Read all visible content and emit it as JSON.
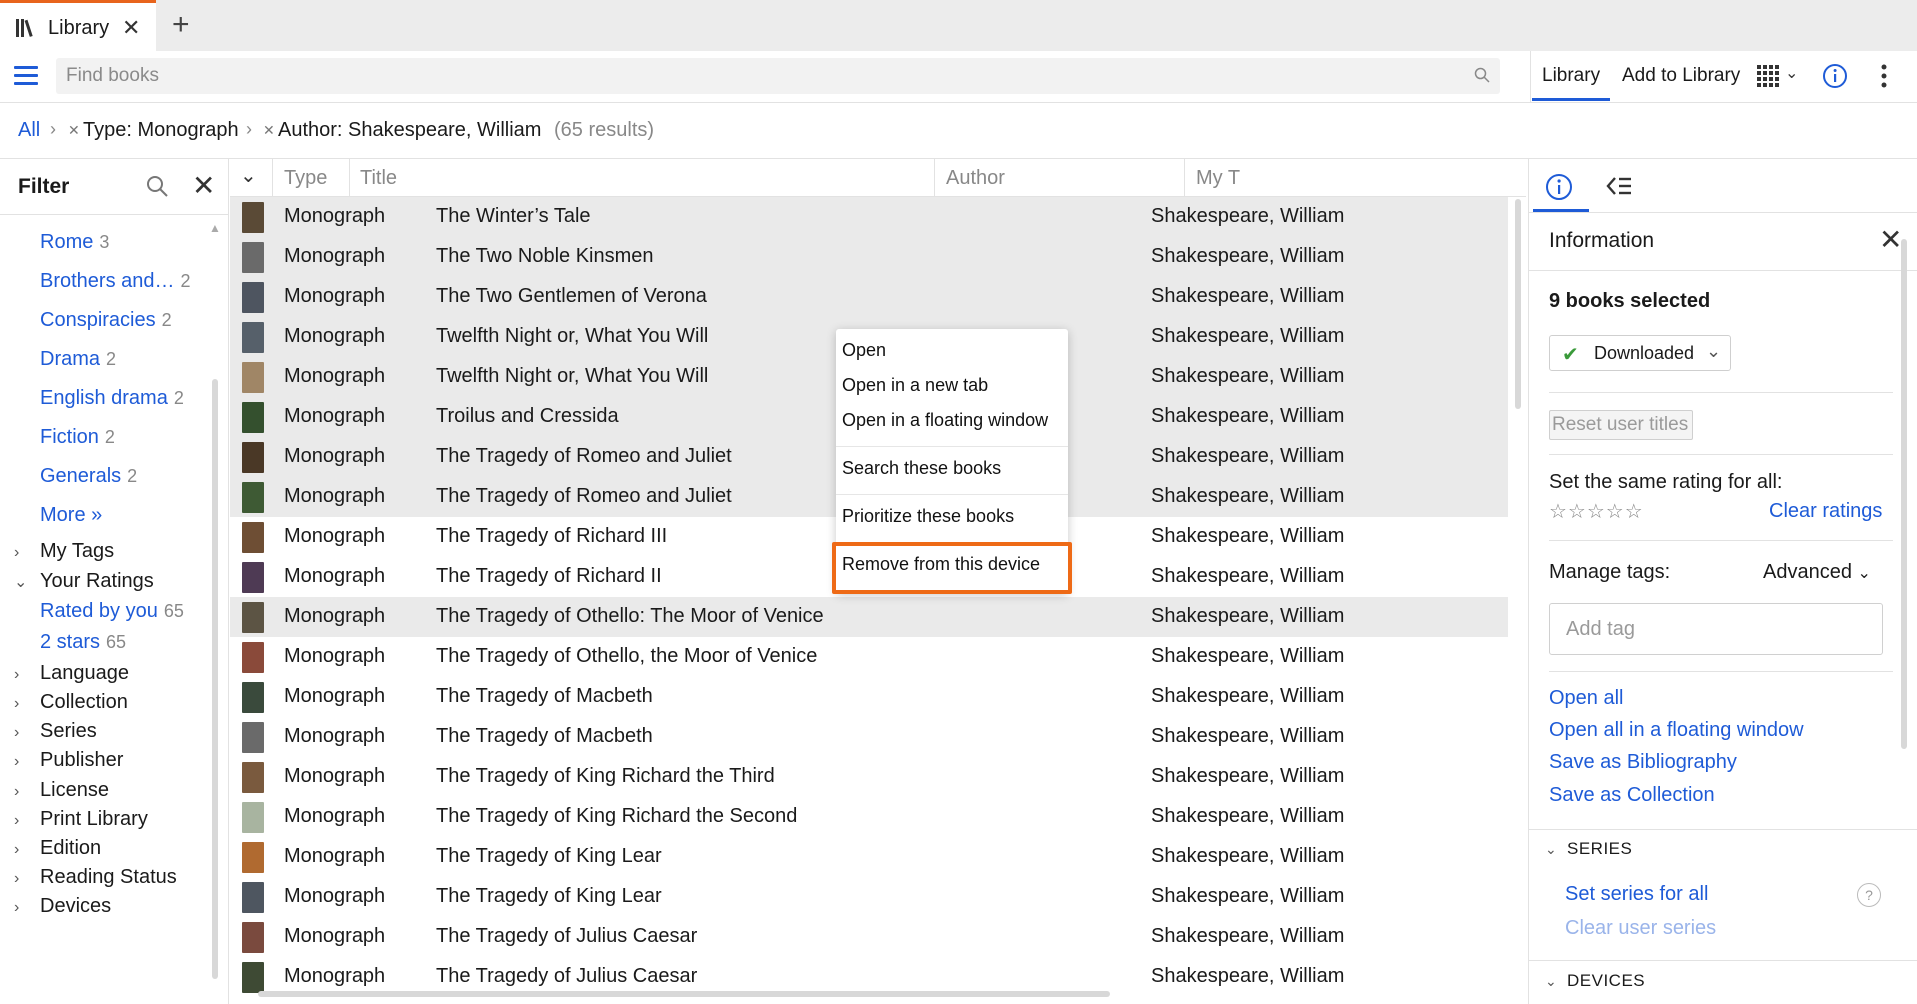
{
  "tab": {
    "label": "Library"
  },
  "toolbar": {
    "search_placeholder": "Find books",
    "tab_library": "Library",
    "tab_add": "Add to Library"
  },
  "breadcrumb": {
    "all": "All",
    "type_filter": "Type: Monograph",
    "author_filter": "Author: Shakespeare, William",
    "results": "(65 results)"
  },
  "filter": {
    "title": "Filter",
    "subjects": [
      {
        "label": "Rome",
        "count": "3"
      },
      {
        "label": "Brothers and…",
        "count": "2"
      },
      {
        "label": "Conspiracies",
        "count": "2"
      },
      {
        "label": "Drama",
        "count": "2"
      },
      {
        "label": "English drama",
        "count": "2"
      },
      {
        "label": "Fiction",
        "count": "2"
      },
      {
        "label": "Generals",
        "count": "2"
      }
    ],
    "more": "More »",
    "my_tags": "My Tags",
    "your_ratings": "Your Ratings",
    "rated_by_you": {
      "label": "Rated by you",
      "count": "65"
    },
    "two_stars": {
      "label": "2 stars",
      "count": "65"
    },
    "categories": [
      "Language",
      "Collection",
      "Series",
      "Publisher",
      "License",
      "Print Library",
      "Edition",
      "Reading Status",
      "Devices"
    ]
  },
  "table": {
    "headers": {
      "type": "Type",
      "title": "Title",
      "author": "Author",
      "my": "My T"
    },
    "rows": [
      {
        "type": "Monograph",
        "title": "The Winter’s Tale",
        "author": "Shakespeare, William",
        "cover": "#5a4a36",
        "selected": true
      },
      {
        "type": "Monograph",
        "title": "The Two Noble Kinsmen",
        "author": "Shakespeare, William",
        "cover": "#6a6a6a",
        "selected": true
      },
      {
        "type": "Monograph",
        "title": "The Two Gentlemen of Verona",
        "author": "Shakespeare, William",
        "cover": "#4e5560",
        "selected": true
      },
      {
        "type": "Monograph",
        "title": "Twelfth Night or, What You Will",
        "author": "Shakespeare, William",
        "cover": "#56606a",
        "selected": true
      },
      {
        "type": "Monograph",
        "title": "Twelfth Night or, What You Will",
        "author": "Shakespeare, William",
        "cover": "#a08666",
        "selected": true
      },
      {
        "type": "Monograph",
        "title": "Troilus and Cressida",
        "author": "Shakespeare, William",
        "cover": "#34502e",
        "selected": true
      },
      {
        "type": "Monograph",
        "title": "The Tragedy of Romeo and Juliet",
        "author": "Shakespeare, William",
        "cover": "#4a3826",
        "selected": true
      },
      {
        "type": "Monograph",
        "title": "The Tragedy of Romeo and Juliet",
        "author": "Shakespeare, William",
        "cover": "#3e5a34",
        "selected": true
      },
      {
        "type": "Monograph",
        "title": "The Tragedy of Richard III",
        "author": "Shakespeare, William",
        "cover": "#6e4e34",
        "selected": false
      },
      {
        "type": "Monograph",
        "title": "The Tragedy of Richard II",
        "author": "Shakespeare, William",
        "cover": "#4e3a54",
        "selected": false
      },
      {
        "type": "Monograph",
        "title": "The Tragedy of Othello: The Moor of Venice",
        "author": "Shakespeare, William",
        "cover": "#5c5444",
        "selected": true
      },
      {
        "type": "Monograph",
        "title": "The Tragedy of Othello, the Moor of Venice",
        "author": "Shakespeare, William",
        "cover": "#8a4a3a",
        "selected": false
      },
      {
        "type": "Monograph",
        "title": "The Tragedy of Macbeth",
        "author": "Shakespeare, William",
        "cover": "#3a4a3c",
        "selected": false
      },
      {
        "type": "Monograph",
        "title": "The Tragedy of Macbeth",
        "author": "Shakespeare, William",
        "cover": "#6a6a6a",
        "selected": false
      },
      {
        "type": "Monograph",
        "title": "The Tragedy of King Richard the Third",
        "author": "Shakespeare, William",
        "cover": "#7a5a3e",
        "selected": false
      },
      {
        "type": "Monograph",
        "title": "The Tragedy of King Richard the Second",
        "author": "Shakespeare, William",
        "cover": "#a8b4a0",
        "selected": false
      },
      {
        "type": "Monograph",
        "title": "The Tragedy of King Lear",
        "author": "Shakespeare, William",
        "cover": "#b06a30",
        "selected": false
      },
      {
        "type": "Monograph",
        "title": "The Tragedy of King Lear",
        "author": "Shakespeare, William",
        "cover": "#4e5660",
        "selected": false
      },
      {
        "type": "Monograph",
        "title": "The Tragedy of Julius Caesar",
        "author": "Shakespeare, William",
        "cover": "#7a4a3e",
        "selected": false
      },
      {
        "type": "Monograph",
        "title": "The Tragedy of Julius Caesar",
        "author": "Shakespeare, William",
        "cover": "#3e4a34",
        "selected": false
      }
    ]
  },
  "context_menu": {
    "open": "Open",
    "open_new_tab": "Open in a new tab",
    "open_floating": "Open in a floating window",
    "search": "Search these books",
    "prioritize": "Prioritize these books",
    "remove": "Remove from this device"
  },
  "info_panel": {
    "title": "Information",
    "selected_count": "9 books selected",
    "downloaded": "Downloaded",
    "reset_titles": "Reset user titles",
    "rating_label": "Set the same rating for all:",
    "stars": "☆☆☆☆☆",
    "clear_ratings": "Clear ratings",
    "manage_tags": "Manage tags:",
    "advanced": "Advanced",
    "tag_placeholder": "Add tag",
    "open_all": "Open all",
    "open_all_floating": "Open all in a floating window",
    "save_bibliography": "Save as Bibliography",
    "save_collection": "Save as Collection",
    "series_heading": "SERIES",
    "set_series": "Set series for all",
    "clear_series": "Clear user series",
    "help": "?",
    "devices_heading": "DEVICES"
  },
  "colors": {
    "accent": "#1e5bd7",
    "highlight": "#ee6a16",
    "selection": "#eaeaea"
  }
}
